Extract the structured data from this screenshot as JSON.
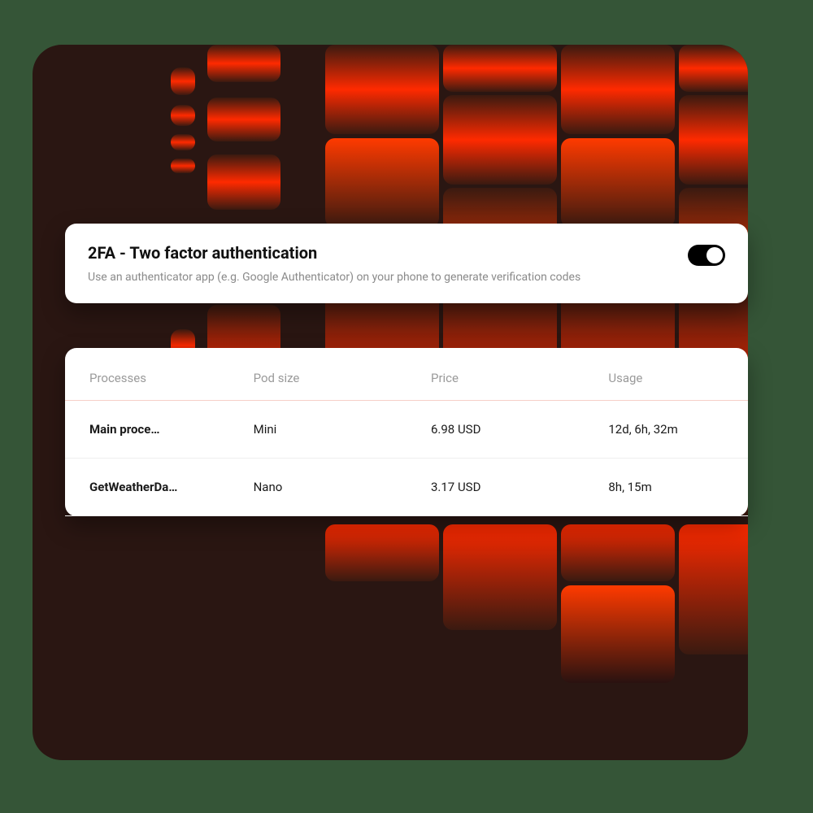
{
  "twofa": {
    "title": "2FA - Two factor authentication",
    "description": "Use an authenticator app (e.g. Google Authenticator) on your phone to generate verification codes",
    "enabled": true
  },
  "table": {
    "headers": {
      "processes": "Processes",
      "pod_size": "Pod size",
      "price": "Price",
      "usage": "Usage"
    },
    "rows": [
      {
        "process": "Main proce…",
        "pod_size": "Mini",
        "price": "6.98 USD",
        "usage": "12d, 6h, 32m"
      },
      {
        "process": "GetWeatherDa…",
        "pod_size": "Nano",
        "price": "3.17 USD",
        "usage": "8h, 15m"
      }
    ]
  }
}
